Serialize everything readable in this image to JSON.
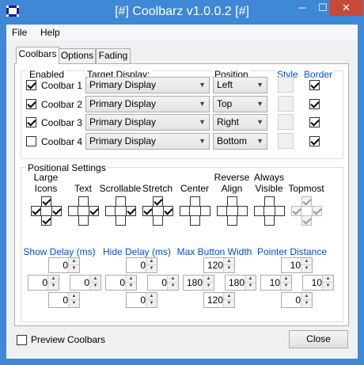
{
  "window": {
    "title": "[#] Coolbarz v1.0.0.2 [#]",
    "minimize_glyph": "─",
    "maximize_glyph": "☐",
    "close_glyph": "✕"
  },
  "menu": {
    "file": "File",
    "help": "Help"
  },
  "tabs": {
    "coolbars": "Coolbars",
    "options": "Options",
    "fading": "Fading",
    "active": "Coolbars"
  },
  "coolbars": {
    "headers": {
      "enabled": "Enabled",
      "target_display": "Target Display:",
      "position": "Position",
      "style": "Style",
      "border": "Border"
    },
    "rows": [
      {
        "label": "Coolbar 1",
        "enabled": true,
        "display": "Primary Display",
        "position": "Left",
        "border": true
      },
      {
        "label": "Coolbar 2",
        "enabled": true,
        "display": "Primary Display",
        "position": "Top",
        "border": true
      },
      {
        "label": "Coolbar 3",
        "enabled": true,
        "display": "Primary Display",
        "position": "Right",
        "border": true
      },
      {
        "label": "Coolbar 4",
        "enabled": false,
        "display": "Primary Display",
        "position": "Bottom",
        "border": true
      }
    ]
  },
  "positional": {
    "title": "Positional Settings",
    "columns": [
      {
        "label1": "Large",
        "label2": "Icons",
        "top": true,
        "left": true,
        "right": true,
        "bottom": true,
        "disabled": false
      },
      {
        "label1": "",
        "label2": "Text",
        "top": false,
        "left": false,
        "right": true,
        "bottom": false,
        "disabled": false
      },
      {
        "label1": "",
        "label2": "Scrollable",
        "top": false,
        "left": false,
        "right": true,
        "bottom": false,
        "disabled": false
      },
      {
        "label1": "",
        "label2": "Stretch",
        "top": true,
        "left": true,
        "right": true,
        "bottom": false,
        "disabled": false
      },
      {
        "label1": "",
        "label2": "Center",
        "top": false,
        "left": false,
        "right": false,
        "bottom": false,
        "disabled": false
      },
      {
        "label1": "Reverse",
        "label2": "Align",
        "top": false,
        "left": false,
        "right": false,
        "bottom": false,
        "disabled": false
      },
      {
        "label1": "Always",
        "label2": "Visible",
        "top": false,
        "left": false,
        "right": false,
        "bottom": false,
        "disabled": false
      },
      {
        "label1": "",
        "label2": "Topmost",
        "top": true,
        "left": true,
        "right": true,
        "bottom": true,
        "disabled": true
      }
    ],
    "spinners": [
      {
        "title": "Show Delay (ms)",
        "top": "0",
        "left": "0",
        "right": "0",
        "bottom": "0"
      },
      {
        "title": "Hide Delay (ms)",
        "top": "0",
        "left": "0",
        "right": "0",
        "bottom": "0"
      },
      {
        "title": "Max Button Width",
        "top": "120",
        "left": "180",
        "right": "180",
        "bottom": "120"
      },
      {
        "title": "Pointer Distance",
        "top": "10",
        "left": "10",
        "right": "10",
        "bottom": "0"
      }
    ]
  },
  "footer": {
    "preview_label": "Preview Coolbars",
    "preview_checked": false,
    "close_label": "Close"
  },
  "colors": {
    "titlebar": "#3f88d6",
    "close_button": "#c7493a",
    "blue_label": "#0050d8"
  },
  "icons": {
    "spin_up": "▲",
    "spin_down": "▼",
    "dropdown": "▼"
  }
}
